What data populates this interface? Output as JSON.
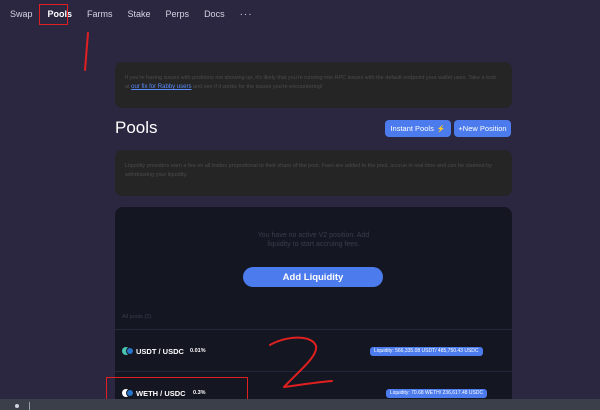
{
  "nav": {
    "items": [
      "Swap",
      "Pools",
      "Farms",
      "Stake",
      "Perps",
      "Docs"
    ],
    "active": "Pools",
    "more": "···"
  },
  "banner": {
    "text_before": "If you're having issues with positions not showing up, it's likely that you're running into RPC issues with the default endpoint your wallet uses. Take a look at",
    "link": "our fix for Rabby users",
    "text_after": "and see if it works for the issues you're encountering!"
  },
  "pools": {
    "title": "Pools",
    "instant_label": "Instant Pools",
    "instant_icon": "lightning-bolt-icon",
    "new_position_label": "+New Position",
    "info_text": "Liquidity providers earn a fee on all trades proportional to their share of the pool. Fees are added to the pool, accrue in real time and can be claimed by withdrawing your liquidity.",
    "empty_line1": "You have no active V2 position. Add",
    "empty_line2": "liquidity to start accruing fees.",
    "add_liquidity_label": "Add Liquidity",
    "all_pools_label": "All pools (2)",
    "rows": [
      {
        "name": "USDT / USDC",
        "fee": "0.01%",
        "liquidity": "Liquidity: 566,335.08 USDT/ 485,750.43 USDC"
      },
      {
        "name": "WETH / USDC",
        "fee": "0.3%",
        "liquidity": "Liquidity: 70.68 WETH/ 236,617.48 USDC"
      }
    ]
  },
  "annotations": {
    "mark_1": "1",
    "mark_2": "2",
    "color": "#e02020"
  }
}
